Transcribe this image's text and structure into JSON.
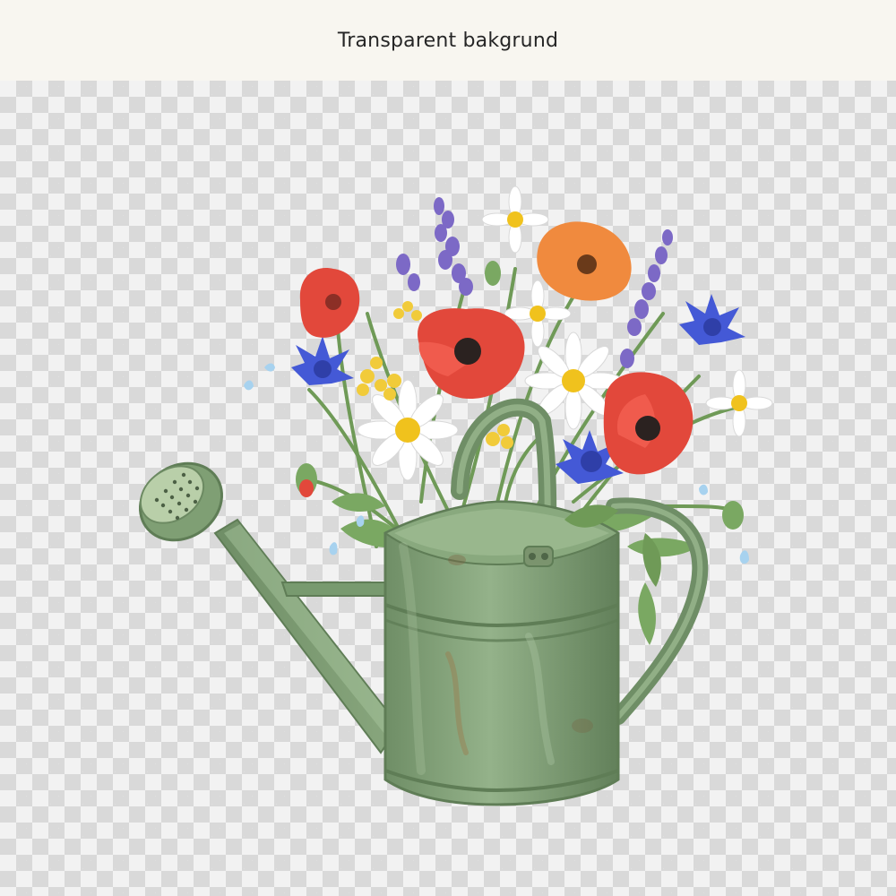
{
  "header": {
    "title": "Transparent bakgrund"
  },
  "colors": {
    "header_bg": "#f8f6f0",
    "checker_light": "#f2f2f2",
    "checker_dark": "#d9d9d9",
    "can_green": "#7f9f74",
    "can_dark": "#5f7d56",
    "poppy_red": "#e2483b",
    "poppy_orange": "#f08a3e",
    "cornflower_blue": "#4459d6",
    "lavender": "#7c69c6",
    "daisy_center": "#f0c21d"
  },
  "illustration": {
    "subject": "watering-can-with-wildflowers",
    "icons": [
      "watering-can-icon",
      "poppy-icon",
      "cornflower-icon",
      "daisy-icon",
      "lavender-icon",
      "water-drop-icon"
    ]
  }
}
